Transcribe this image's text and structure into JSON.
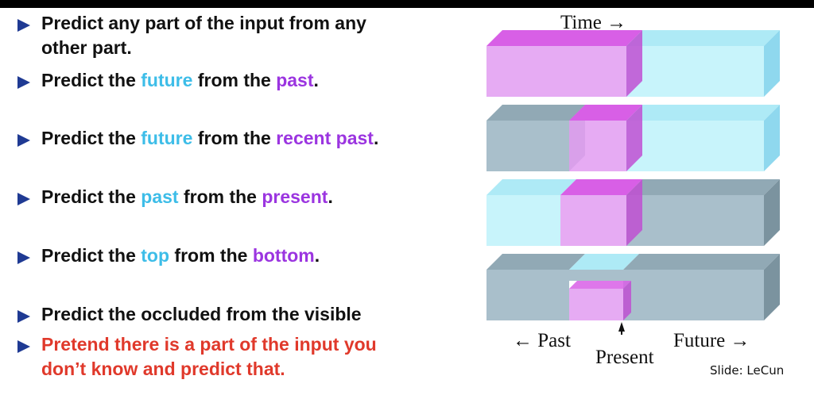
{
  "bullets": [
    {
      "parts": [
        "Predict any part of the input from any",
        "other part."
      ]
    },
    {
      "p1": "Predict the ",
      "c1": "future",
      "p2": " from the ",
      "c2": "past",
      "p3": "."
    },
    {
      "p1": "Predict the ",
      "c1": "future",
      "p2": " from the ",
      "c2": "recent past",
      "p3": "."
    },
    {
      "p1": "Predict the ",
      "c1": "past",
      "p2": " from the ",
      "c2": "present",
      "p3": "."
    },
    {
      "p1": "Predict the ",
      "c1": "top",
      "p2": " from the ",
      "c2": "bottom",
      "p3": "."
    },
    {
      "text": "Predict the occluded from the visible"
    },
    {
      "parts": [
        "Pretend there is a part of the input you",
        "don’t know and predict that."
      ]
    }
  ],
  "diagram": {
    "time_label": "Time →",
    "past_label": "← Past",
    "present_label": "Present",
    "future_label": "Future →"
  },
  "credit": "Slide: LeCun",
  "colors": {
    "bullet_marker": "#1f3a93",
    "cyan_highlight": "#3dbde8",
    "purple_highlight": "#9b35e0",
    "red_text": "#e0392b",
    "block_cyan": "#c8f4fb",
    "block_gray": "#a9bfcb",
    "block_pink": "#e3a2f2"
  }
}
